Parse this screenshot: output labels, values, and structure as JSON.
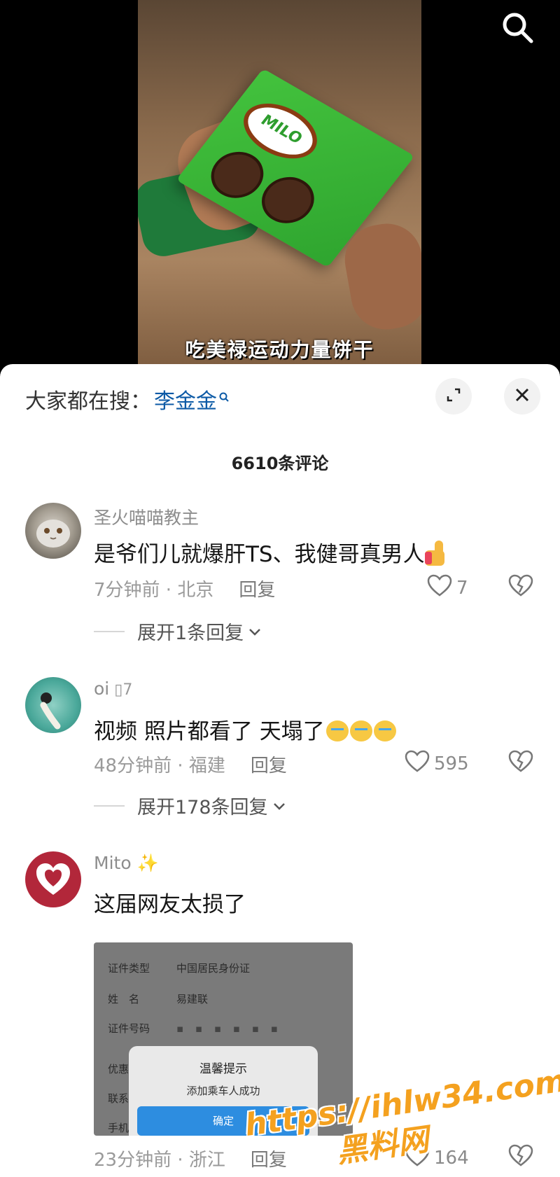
{
  "video": {
    "caption": "吃美禄运动力量饼干",
    "package_brand": "MILO"
  },
  "hot_search": {
    "prefix": "大家都在搜：",
    "term": "李金金"
  },
  "comment_count": "6610条评论",
  "comments": [
    {
      "username": "圣火喵喵教主",
      "text": "是爷们儿就爆肝TS、我健哥真男人",
      "time_location": "7分钟前 · 北京",
      "reply_label": "回复",
      "likes": "7",
      "expand_label": "展开1条回复"
    },
    {
      "username": "oi",
      "text": "视频 照片都看了 天塌了",
      "time_location": "48分钟前 · 福建",
      "reply_label": "回复",
      "likes": "595",
      "expand_label": "展开178条回复"
    },
    {
      "username": "Mito",
      "text": "这届网友太损了",
      "time_location": "23分钟前 · 浙江",
      "reply_label": "回复",
      "likes": "164",
      "screenshot": {
        "row1_label": "证件类型",
        "row1_value": "中国居民身份证",
        "row2_label": "姓　名",
        "row2_value": "易建联",
        "row3_label": "证件号码",
        "row4_label": "优惠",
        "row5_label": "联系方",
        "row6_label": "手机",
        "dialog_title": "温馨提示",
        "dialog_message": "添加乘车人成功",
        "dialog_ok": "确定"
      }
    }
  ],
  "watermark": {
    "line1": "https://ihlw34.com",
    "line2": "黑料网"
  },
  "icons": {
    "search": "search-icon",
    "collapse": "collapse-icon",
    "close": "close-icon",
    "heart": "heart-icon",
    "broken_heart": "broken-heart-icon",
    "chevron": "chevron-down-icon"
  }
}
